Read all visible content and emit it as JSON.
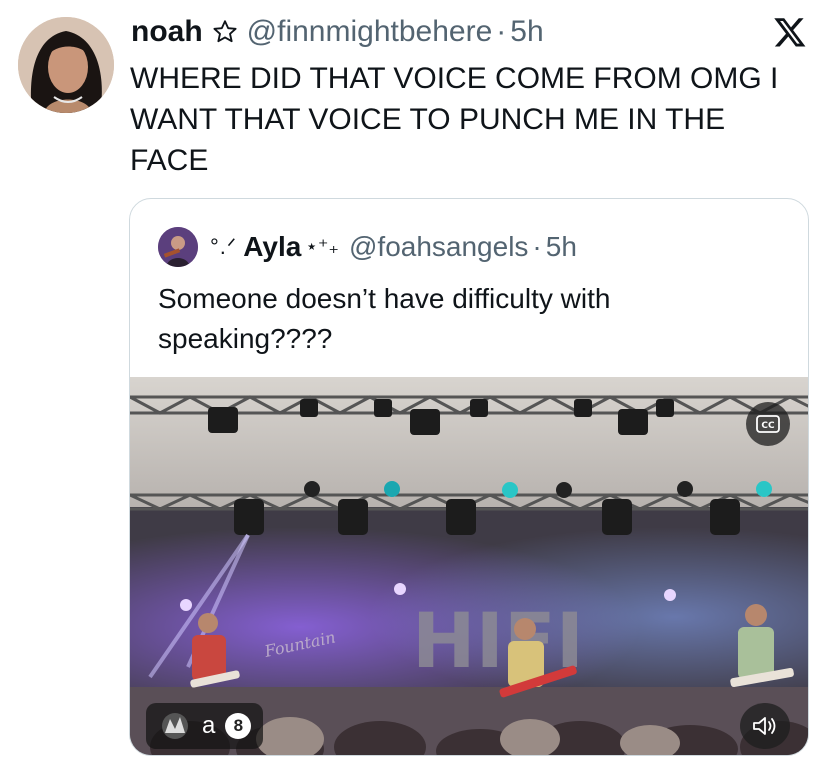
{
  "tweet": {
    "author": {
      "display_name": "noah",
      "handle": "@finnmightbehere",
      "time": "5h",
      "avatar_icon": "profile-photo"
    },
    "separator": "·",
    "text": "WHERE DID THAT VOICE COME FROM OMG I WANT THAT VOICE TO PUNCH ME IN THE FACE",
    "platform_icon": "x-logo-icon",
    "star_icon": "star-outline-icon"
  },
  "quote": {
    "author": {
      "prefix_deco": "°.ᐟ",
      "display_name": "Ayla",
      "suffix_deco": "⋆⁺₊",
      "handle": "@foahsangels",
      "time": "5h"
    },
    "separator": "·",
    "text": "Someone doesn’t have difficulty with speaking????",
    "media": {
      "type": "video",
      "cc_label": "CC",
      "viewer_label": "a",
      "viewer_badge": "8",
      "banner_text": "HIFI",
      "sign_text": "Fountain",
      "accent_light": "#8a5cff"
    }
  },
  "colors": {
    "text_primary": "#0f1419",
    "text_secondary": "#536471",
    "card_border": "#cfd9de"
  }
}
